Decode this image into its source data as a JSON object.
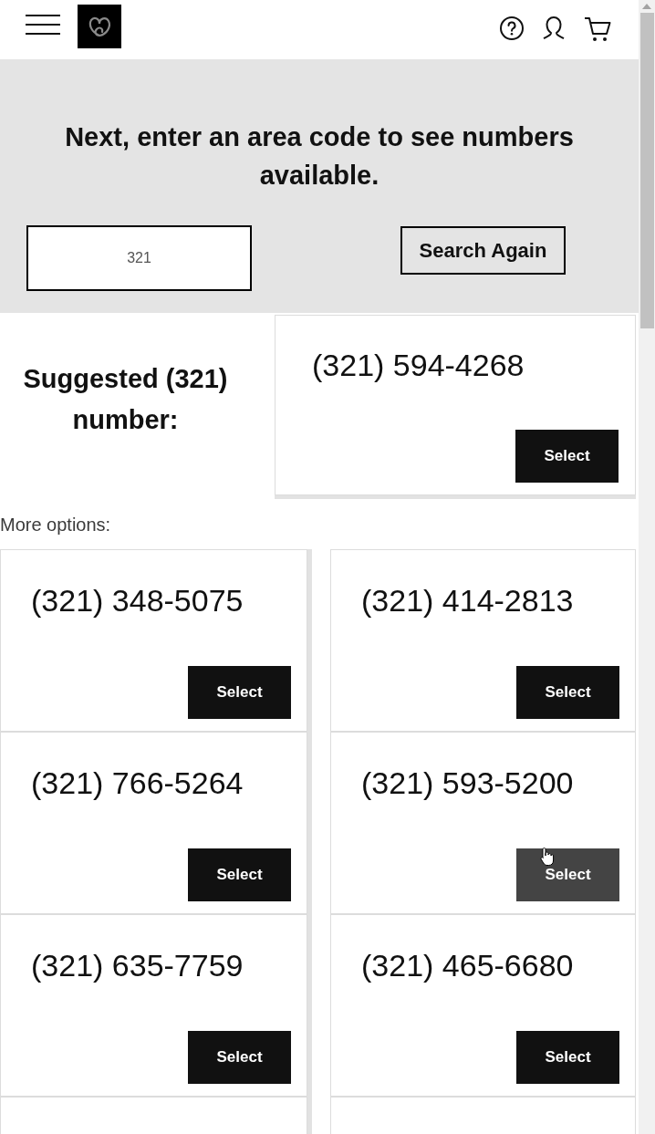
{
  "search": {
    "heading": "Next, enter an area code to see numbers available.",
    "value": "321",
    "button": "Search Again"
  },
  "suggested": {
    "label": "Suggested (321) number:",
    "number": "(321) 594-4268",
    "button": "Select"
  },
  "more_options": {
    "label": "More options:",
    "options": [
      {
        "kind": "number",
        "number": "(321) 348-5075",
        "button": "Select",
        "hovered": false
      },
      {
        "kind": "number",
        "number": "(321) 414-2813",
        "button": "Select",
        "hovered": false
      },
      {
        "kind": "number",
        "number": "(321) 766-5264",
        "button": "Select",
        "hovered": false
      },
      {
        "kind": "number",
        "number": "(321) 593-5200",
        "button": "Select",
        "hovered": true
      },
      {
        "kind": "number",
        "number": "(321) 635-7759",
        "button": "Select",
        "hovered": false
      },
      {
        "kind": "number",
        "number": "(321) 465-6680",
        "button": "Select",
        "hovered": false
      },
      {
        "kind": "cut"
      },
      {
        "kind": "cut"
      }
    ]
  }
}
